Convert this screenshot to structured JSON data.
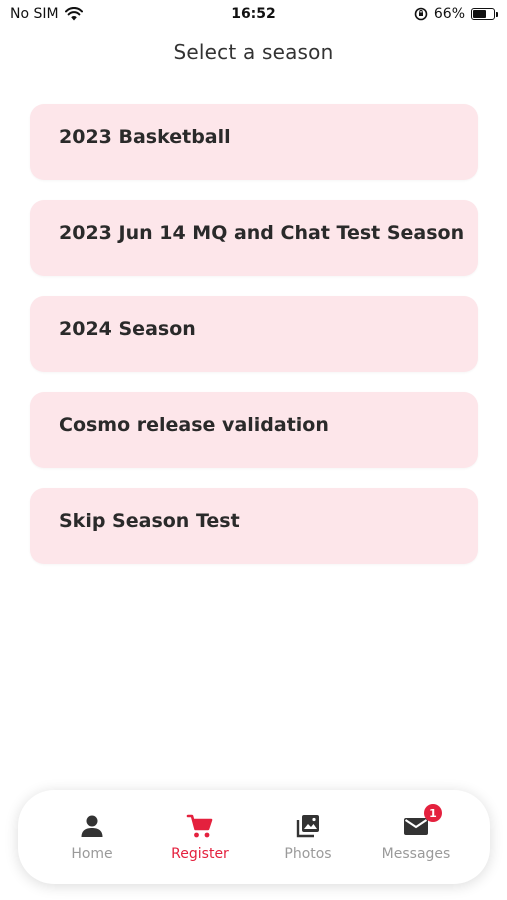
{
  "status_bar": {
    "carrier": "No SIM",
    "time": "16:52",
    "battery_percent": "66%",
    "battery_level": 0.66
  },
  "header": {
    "title": "Select a season"
  },
  "seasons": [
    {
      "label": "2023 Basketball"
    },
    {
      "label": "2023 Jun 14 MQ and Chat Test Season"
    },
    {
      "label": "2024 Season"
    },
    {
      "label": "Cosmo release validation"
    },
    {
      "label": "Skip Season Test"
    }
  ],
  "tab_bar": {
    "tabs": [
      {
        "label": "Home",
        "icon": "person-icon"
      },
      {
        "label": "Register",
        "icon": "cart-icon",
        "active": true
      },
      {
        "label": "Photos",
        "icon": "photos-icon"
      },
      {
        "label": "Messages",
        "icon": "mail-icon",
        "badge": "1"
      }
    ]
  },
  "colors": {
    "accent": "#e4213e",
    "card_background": "#fde6ea",
    "inactive_tab": "#9a9a9a"
  }
}
